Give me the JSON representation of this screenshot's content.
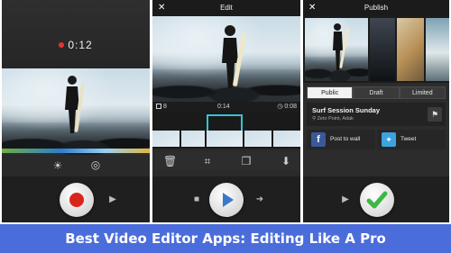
{
  "recorder": {
    "timer": "0:12",
    "icons": [
      "brightness-icon",
      "flip-camera-icon",
      "record-icon",
      "play-icon"
    ]
  },
  "editor": {
    "title": "Edit",
    "close": "✕",
    "clip_count": "8",
    "current_time": "0:14",
    "clip_length": "0:08",
    "tools": [
      "delete-icon",
      "crop-icon",
      "duplicate-icon",
      "save-icon"
    ]
  },
  "publish": {
    "title": "Publish",
    "close": "✕",
    "tabs": [
      "Public",
      "Draft",
      "Limited"
    ],
    "active_tab": "Public",
    "video_title": "Surf Session Sunday",
    "location": "Zeto Point, Adak",
    "share": {
      "facebook": "Post to wall",
      "twitter": "Tweet"
    }
  },
  "banner": {
    "text": "Best Video Editor Apps: Editing Like A Pro"
  },
  "colors": {
    "record_red": "#d9261c",
    "accent_cyan": "#33c3d6",
    "play_blue": "#3b79c7",
    "check_green": "#3db843",
    "banner_blue": "#4b6ddb",
    "facebook": "#3b5998",
    "twitter": "#3ba4e0"
  }
}
